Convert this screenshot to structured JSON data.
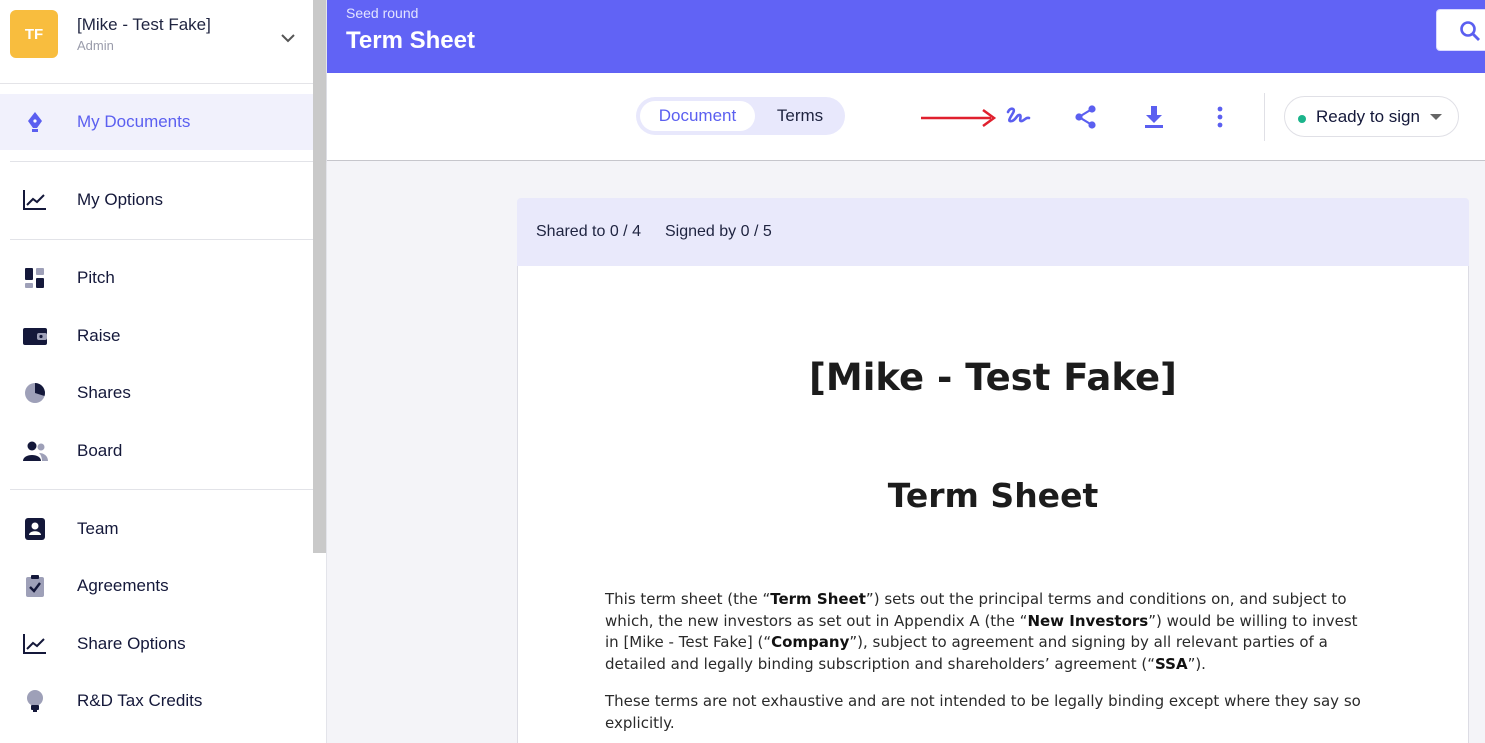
{
  "org": {
    "initials": "TF",
    "name": "[Mike - Test Fake]",
    "role": "Admin"
  },
  "sidebar": {
    "items": [
      {
        "label": "My Documents",
        "icon": "pen-nib-icon",
        "active": true
      },
      {
        "label": "My Options",
        "icon": "line-chart-icon"
      },
      {
        "label": "Pitch",
        "icon": "dashboard-icon"
      },
      {
        "label": "Raise",
        "icon": "wallet-icon"
      },
      {
        "label": "Shares",
        "icon": "pie-chart-icon"
      },
      {
        "label": "Board",
        "icon": "people-icon"
      },
      {
        "label": "Team",
        "icon": "id-badge-icon"
      },
      {
        "label": "Agreements",
        "icon": "clipboard-check-icon"
      },
      {
        "label": "Share Options",
        "icon": "line-chart-icon"
      },
      {
        "label": "R&D Tax Credits",
        "icon": "lightbulb-icon"
      }
    ]
  },
  "header": {
    "kicker": "Seed round",
    "title": "Term Sheet"
  },
  "toolbar": {
    "tabs": [
      {
        "label": "Document",
        "active": true
      },
      {
        "label": "Terms",
        "active": false
      }
    ],
    "status_label": "Ready to sign",
    "colors": {
      "accent": "#5b5ff0",
      "header": "#6163f5",
      "status_dot": "#1bb48b",
      "annotation_arrow": "#e0202e"
    }
  },
  "document": {
    "shared_text": "Shared to 0 / 4",
    "signed_text": "Signed by 0 / 5",
    "heading": "[Mike - Test Fake]",
    "subheading": "Term Sheet",
    "p1": {
      "t1": "This term sheet (the “",
      "b1": "Term Sheet",
      "t2": "”) sets out the principal terms and conditions on, and subject to which, the new investors as set out in Appendix A (the “",
      "b2": "New Investors",
      "t3": "”) would be willing to invest in [Mike - Test Fake] (“",
      "b3": "Company",
      "t4": "”), subject to agreement and signing by all relevant parties of a detailed and legally binding subscription and shareholders’ agreement (“",
      "b4": "SSA",
      "t5": "”)."
    },
    "p2": "These terms are not exhaustive and are not intended to be legally binding except where they say so explicitly."
  }
}
